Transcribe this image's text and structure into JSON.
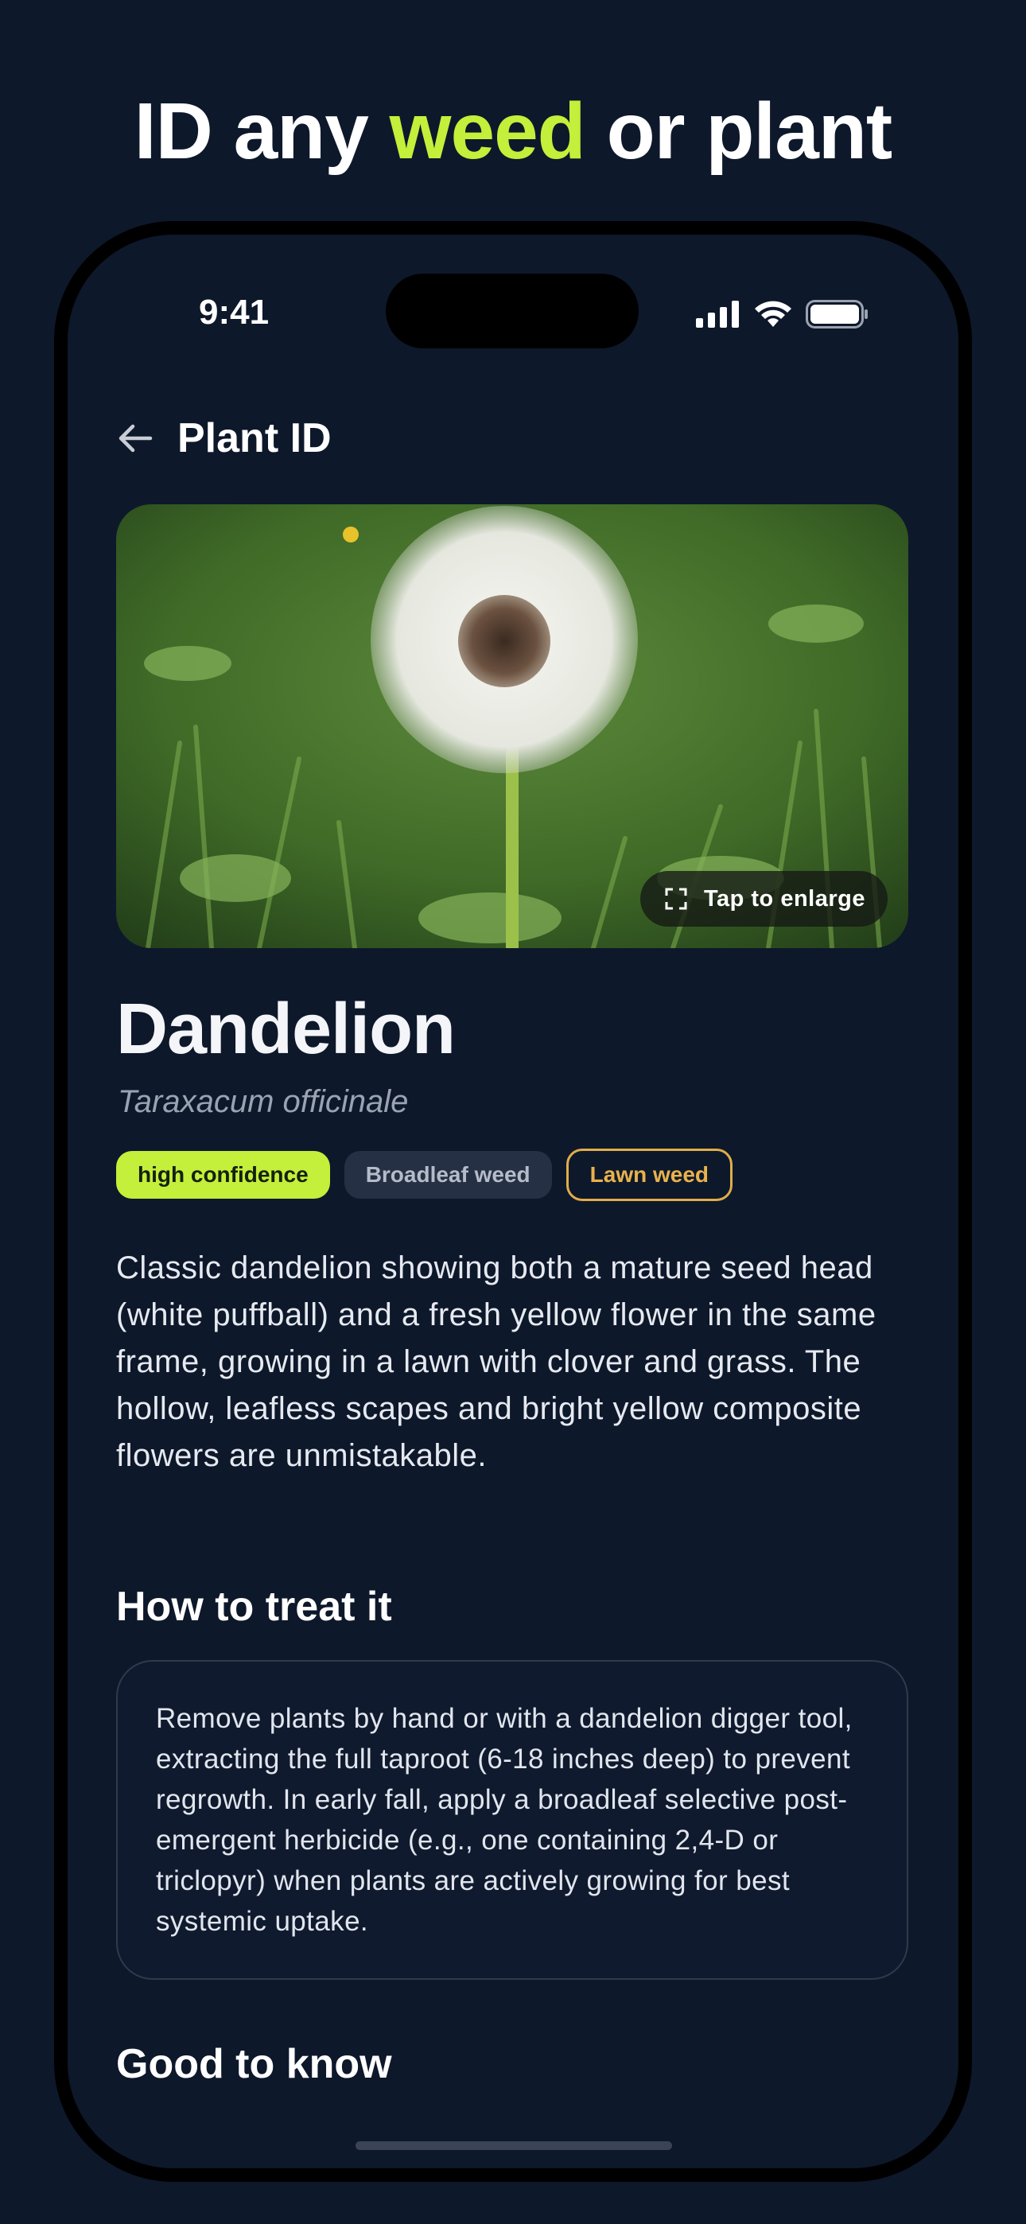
{
  "marketing": {
    "headline_pre": "ID any ",
    "headline_accent": "weed",
    "headline_post": " or plant"
  },
  "status_bar": {
    "time": "9:41"
  },
  "nav": {
    "title": "Plant ID",
    "back_icon": "arrow-left-icon"
  },
  "photo": {
    "alt": "Dandelion seed head in lawn",
    "enlarge_label": "Tap to enlarge",
    "enlarge_icon": "expand-icon"
  },
  "plant": {
    "common_name": "Dandelion",
    "scientific_name": "Taraxacum officinale",
    "badges": [
      {
        "label": "high confidence",
        "kind": "confidence"
      },
      {
        "label": "Broadleaf weed",
        "kind": "type"
      },
      {
        "label": "Lawn weed",
        "kind": "category"
      }
    ],
    "description": "Classic dandelion showing both a mature seed head (white puffball) and a fresh yellow flower in the same frame, growing in a lawn with clover and grass. The hollow, leafless scapes and bright yellow composite flowers are unmistakable."
  },
  "treatment": {
    "heading": "How to treat it",
    "text": "Remove plants by hand or with a dandelion digger tool, extracting the full taproot (6-18 inches deep) to prevent regrowth. In early fall, apply a broadleaf selective post-emergent herbicide (e.g., one containing 2,4-D or triclopyr) when plants are actively growing for best systemic uptake."
  },
  "good_to_know": {
    "heading": "Good to know"
  },
  "colors": {
    "background": "#0e182b",
    "accent": "#c4ef3a",
    "lawn_badge": "#e0ad4a"
  }
}
